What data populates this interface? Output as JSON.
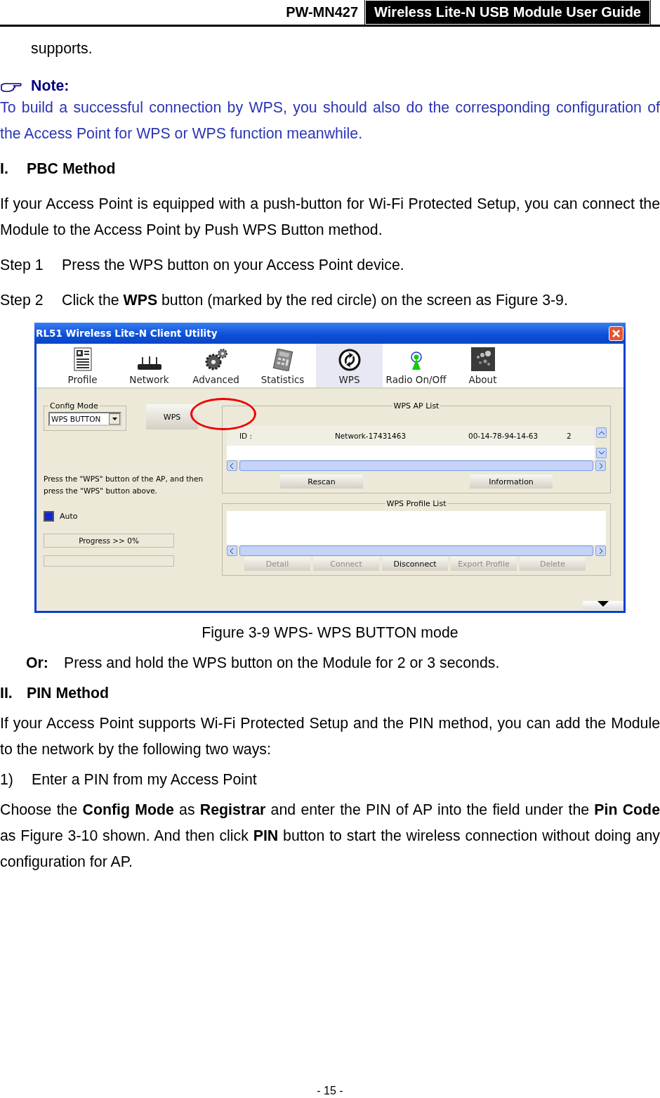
{
  "header": {
    "model": "PW-MN427",
    "title": "Wireless Lite-N USB Module User Guide"
  },
  "blocks": [
    {
      "kind": "continuation",
      "text": "supports."
    },
    {
      "kind": "note",
      "text": "Note:"
    },
    {
      "kind": "note_text",
      "text": "To build a successful connection by WPS, you should also do the corresponding configuration of the Access Point for WPS or WPS function meanwhile."
    },
    {
      "kind": "heading",
      "number": "I.",
      "text": "PBC Method"
    },
    {
      "kind": "text",
      "text": "If your Access Point is equipped with a push-button for Wi-Fi Protected Setup, you can connect the Module to the Access Point by Push WPS Button method."
    },
    {
      "kind": "step",
      "number": "Step 1",
      "text": "Press the WPS button on your Access Point device."
    },
    {
      "kind": "step",
      "number": "Step 2",
      "text": "Click the **WPS** button (marked by the red circle) on the screen as Figure 3-9."
    },
    {
      "kind": "figure"
    },
    {
      "kind": "caption",
      "text": "Figure 3-9 WPS- WPS BUTTON mode"
    },
    {
      "kind": "or",
      "number": "Or:",
      "text": "Press and hold the WPS button on the Module for 2 or 3 seconds."
    },
    {
      "kind": "heading",
      "number": "II.",
      "text": "PIN Method"
    },
    {
      "kind": "text",
      "text": "If your Access Point supports Wi-Fi Protected Setup and the PIN method, you can add the Module to the network by the following two ways:"
    },
    {
      "kind": "step",
      "number": "1)",
      "text": "Enter a PIN from my Access Point"
    },
    {
      "kind": "text",
      "text": "Choose the **Config Mode** as **Registrar** and enter the PIN of AP into the field under the **Pin Code** as Figure 3-10 shown. And then click **PIN** button to start the wireless connection without doing any configuration for AP."
    }
  ],
  "window": {
    "title": "RL51 Wireless Lite-N Client Utility",
    "tabs": [
      {
        "label": "Profile",
        "selected": false
      },
      {
        "label": "Network",
        "selected": false
      },
      {
        "label": "Advanced",
        "selected": false
      },
      {
        "label": "Statistics",
        "selected": false
      },
      {
        "label": "WPS",
        "selected": true
      },
      {
        "label": "Radio On/Off",
        "selected": false
      },
      {
        "label": "About",
        "selected": false
      }
    ],
    "config_mode": {
      "legend": "Config Mode",
      "value": "WPS BUTTON"
    },
    "wps_button": "WPS",
    "instruction": "Press the \"WPS\" button of the AP, and then press the \"WPS\" button above.",
    "auto": {
      "label": "Auto",
      "checked": true
    },
    "progress": {
      "text": "Progress >> 0%",
      "level": 0
    },
    "ap_list": {
      "legend": "WPS AP List",
      "row": [
        "ID :",
        "Network-17431463",
        "00-14-78-94-14-63",
        "2"
      ],
      "buttons": [
        {
          "label": "Rescan",
          "disabled": false
        },
        {
          "label": "Information",
          "disabled": false
        }
      ]
    },
    "profile_list": {
      "legend": "WPS Profile List",
      "buttons": [
        {
          "label": "Detail",
          "disabled": true
        },
        {
          "label": "Connect",
          "disabled": true
        },
        {
          "label": "Disconnect",
          "disabled": false
        },
        {
          "label": "Export Profile",
          "disabled": true
        },
        {
          "label": "Delete",
          "disabled": true
        }
      ]
    }
  },
  "footer": {
    "page": "- 15 -"
  }
}
